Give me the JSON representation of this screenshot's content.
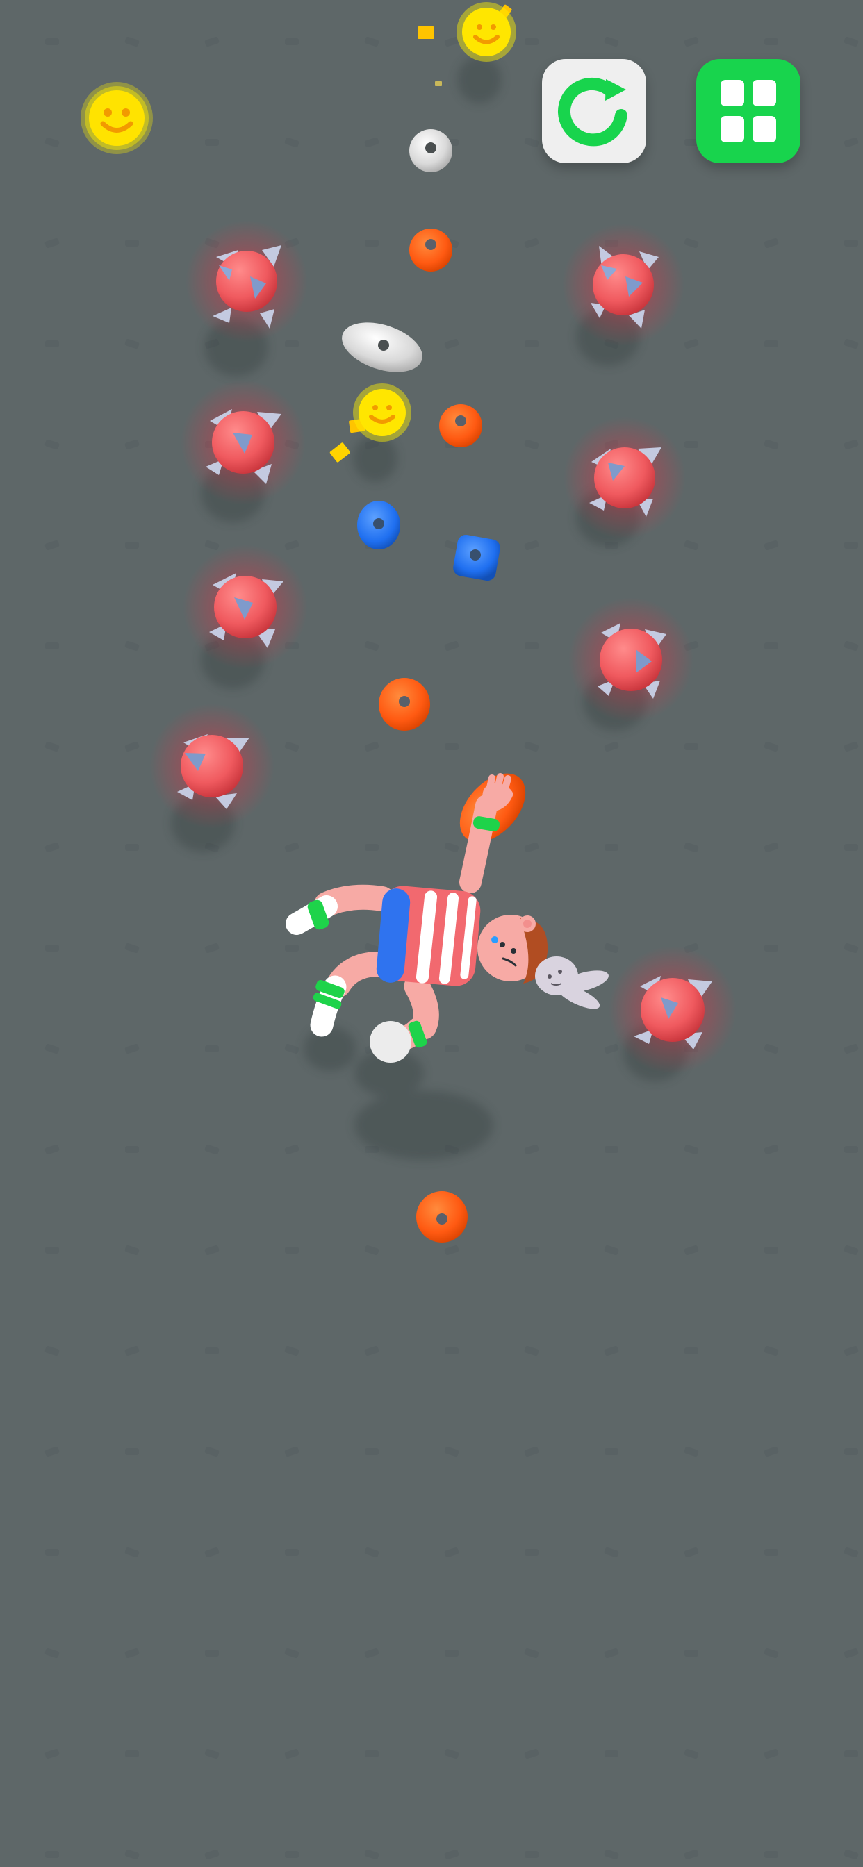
{
  "screen": {
    "background_color": "#5e6768",
    "texture_color": "#565f60"
  },
  "hud": {
    "score_icon": "smiley-icon",
    "restart_icon": "restart-arrow-icon",
    "restart_color": "#efefef",
    "restart_accent": "#18d44d",
    "menu_icon": "grid-icon",
    "menu_color": "#18d44d",
    "menu_accent": "#ffffff"
  },
  "level_elements": {
    "hazards": [
      {
        "type": "spiked-ball",
        "color": "#f05a5f",
        "spike_color": "#aeb8d3"
      },
      {
        "type": "spiked-ball",
        "color": "#f05a5f",
        "spike_color": "#aeb8d3"
      },
      {
        "type": "spiked-ball",
        "color": "#f05a5f",
        "spike_color": "#aeb8d3"
      },
      {
        "type": "spiked-ball",
        "color": "#f05a5f",
        "spike_color": "#aeb8d3"
      },
      {
        "type": "spiked-ball",
        "color": "#f05a5f",
        "spike_color": "#aeb8d3"
      },
      {
        "type": "spiked-ball",
        "color": "#f05a5f",
        "spike_color": "#aeb8d3"
      },
      {
        "type": "spiked-ball",
        "color": "#f05a5f",
        "spike_color": "#aeb8d3"
      },
      {
        "type": "spiked-ball",
        "color": "#f05a5f",
        "spike_color": "#aeb8d3"
      }
    ],
    "holds": [
      {
        "type": "round-hold",
        "color": "#ff5a12"
      },
      {
        "type": "round-hold",
        "color": "#ff5a12"
      },
      {
        "type": "round-hold",
        "color": "#ff5a12"
      },
      {
        "type": "round-hold",
        "color": "#ff5a12"
      },
      {
        "type": "round-hold",
        "color": "#d9d9d9"
      },
      {
        "type": "pill-hold",
        "color": "#dfdfdf"
      },
      {
        "type": "round-hold",
        "color": "#1f6ff0"
      },
      {
        "type": "square-hold",
        "color": "#1d66e0"
      },
      {
        "type": "pill-hold",
        "color": "#ff5a12"
      }
    ],
    "collectibles": [
      {
        "type": "smiley-coin",
        "color": "#ffe500"
      },
      {
        "type": "smiley-coin",
        "color": "#ffe500"
      }
    ]
  },
  "character": {
    "name_icon": "climber-character",
    "shirt_colors": [
      "#f2696f",
      "#ffffff",
      "#2f73ef"
    ],
    "skin_color": "#f7aaa5",
    "band_color": "#1ed34a",
    "hair_color": "#b14d22",
    "toy_icon": "bunny-toy-icon"
  }
}
